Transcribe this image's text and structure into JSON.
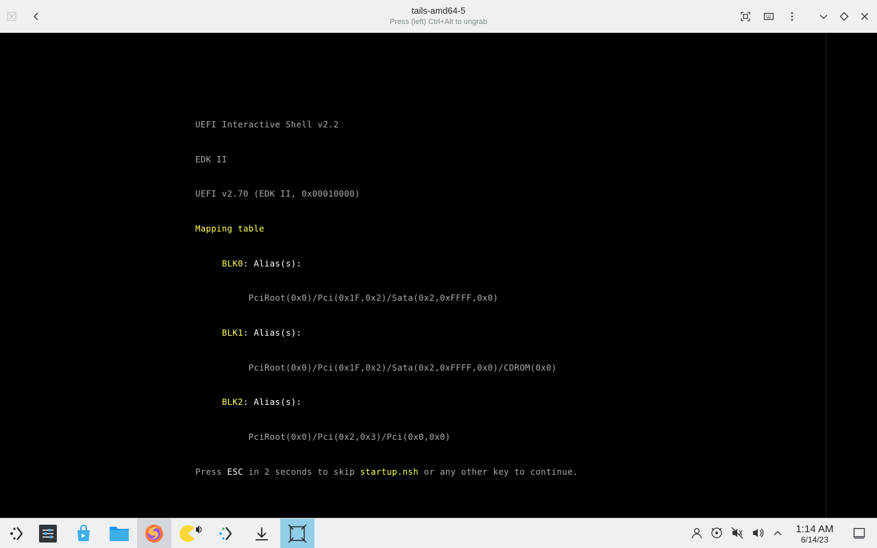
{
  "window": {
    "title": "tails-amd64-5",
    "subtitle": "Press (left) Ctrl+Alt to ungrab"
  },
  "titlebar_icons": [
    "app-icon",
    "back-icon",
    "fit-window-icon",
    "keyboard-icon",
    "more-options-icon",
    "minimize-icon",
    "keep-above-icon",
    "close-icon"
  ],
  "console": {
    "l1": "UEFI Interactive Shell v2.2",
    "l2": "EDK II",
    "l3": "UEFI v2.70 (EDK II, 0x00010000)",
    "l4": "Mapping table",
    "blk0_name": "BLK0",
    "blk0_alias": "Alias(s):",
    "blk0_path": "PciRoot(0x0)/Pci(0x1F,0x2)/Sata(0x2,0xFFFF,0x0)",
    "blk1_name": "BLK1",
    "blk1_alias": "Alias(s):",
    "blk1_path": "PciRoot(0x0)/Pci(0x1F,0x2)/Sata(0x2,0xFFFF,0x0)/CDROM(0x0)",
    "blk2_name": "BLK2",
    "blk2_alias": "Alias(s):",
    "blk2_path": "PciRoot(0x0)/Pci(0x2,0x3)/Pci(0x0,0x0)",
    "prompt_pre": "Press ",
    "prompt_esc": "ESC",
    "prompt_mid": " in 2 seconds to skip ",
    "prompt_file": "startup.nsh",
    "prompt_post": " or any other key to continue."
  },
  "taskbar": {
    "apps": [
      "application-launcher-icon",
      "system-settings-icon",
      "discover-icon",
      "files-icon",
      "firefox-icon",
      "kde-connect-icon",
      "kdeconnect-arrow-icon",
      "downloads-icon",
      "virt-viewer-icon"
    ],
    "tray": [
      "user-icon",
      "network-icon",
      "muted-audio-icon",
      "volume-icon",
      "expand-tray-icon"
    ],
    "time": "1:14 AM",
    "date": "6/14/23",
    "accent": "#93cee9"
  }
}
